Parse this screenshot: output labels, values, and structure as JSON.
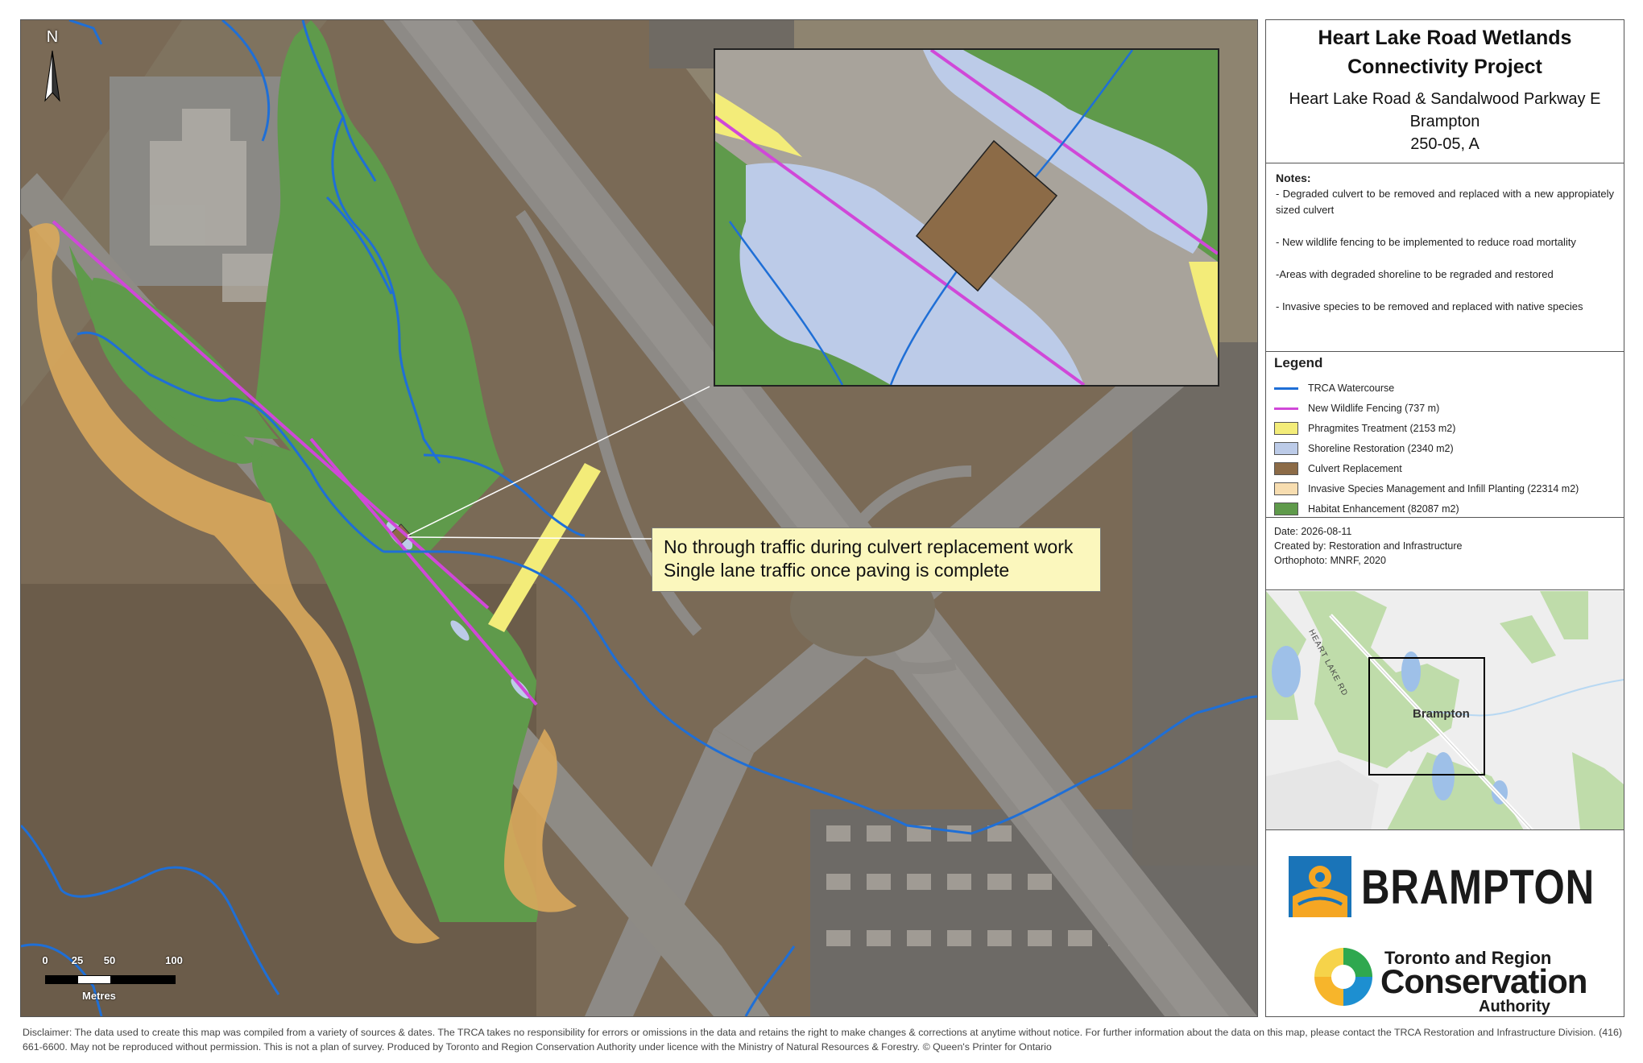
{
  "title": {
    "line1": "Heart Lake Road Wetlands",
    "line2": "Connectivity Project",
    "location": "Heart Lake Road & Sandalwood Parkway E",
    "city": "Brampton",
    "code": "250-05, A"
  },
  "notes": {
    "heading": "Notes:",
    "items": [
      "- Degraded culvert to be removed and replaced with a new appropiately sized culvert",
      "- New wildlife fencing to be implemented to reduce road mortality",
      "-Areas with degraded shoreline to be regraded and restored",
      "- Invasive species to be removed and replaced with native species"
    ]
  },
  "legend": {
    "heading": "Legend",
    "items": [
      {
        "label": "TRCA Watercourse",
        "kind": "line",
        "color": "#1f6fd6"
      },
      {
        "label": "New Wildlife Fencing (737 m)",
        "kind": "line",
        "color": "#d048d8"
      },
      {
        "label": "Phragmites Treatment (2153 m2)",
        "kind": "fill",
        "color": "#f3ec79"
      },
      {
        "label": "Shoreline Restoration (2340 m2)",
        "kind": "fill",
        "color": "#bccbe8"
      },
      {
        "label": "Culvert Replacement",
        "kind": "fill",
        "color": "#8c6b47"
      },
      {
        "label": "Invasive Species Management and Infill Planting (22314 m2)",
        "kind": "fill",
        "color": "#f7ddb0"
      },
      {
        "label": "Habitat Enhancement (82087 m2)",
        "kind": "fill",
        "color": "#5f9a4b"
      }
    ]
  },
  "meta": {
    "date": "Date: 2026-08-11",
    "created_by": "Created by:  Restoration and Infrastructure",
    "orthophoto": "Orthophoto: MNRF, 2020"
  },
  "inset": {
    "label": "Brampton",
    "road_label": "HEART LAKE RD"
  },
  "map": {
    "north": "N",
    "callout_line1": "No through traffic during culvert replacement work",
    "callout_line2": "Single lane traffic once paving is complete",
    "scale_ticks": [
      "0",
      "25",
      "50",
      "100"
    ],
    "scale_unit": "Metres"
  },
  "logos": {
    "brampton": "BRAMPTON",
    "trca_line1": "Toronto and Region",
    "trca_line2": "Conservation",
    "trca_line3": "Authority"
  },
  "disclaimer": "Disclaimer: The data used to create this map was compiled from a variety of sources & dates. The TRCA takes no responsibility for errors or omissions in the data and retains the right to make changes & corrections at anytime without notice. For further information about the data on this map, please contact the TRCA Restoration and Infrastructure Division. (416) 661-6600. May not be reproduced without permission. This is not a plan of survey. Produced by Toronto and Region Conservation Authority under licence with the Ministry of Natural Resources & Forestry. © Queen's Printer for Ontario",
  "colors": {
    "watercourse": "#1f6fd6",
    "fencing": "#d048d8",
    "phragmites": "#f3ec79",
    "shoreline": "#bccbe8",
    "culvert": "#8c6b47",
    "invasive": "#d9a95c",
    "habitat": "#5f9a4b"
  }
}
